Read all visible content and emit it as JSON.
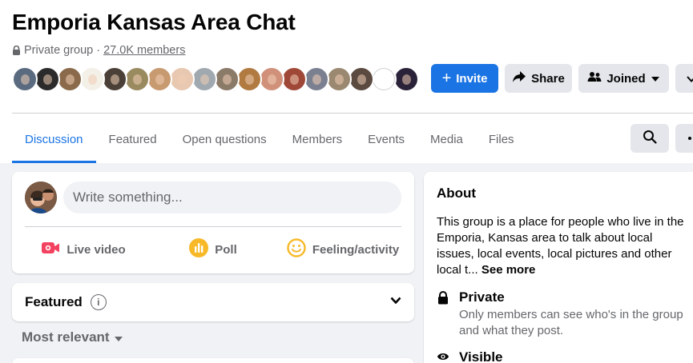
{
  "group": {
    "title": "Emporia Kansas Area Chat",
    "privacy": "Private group",
    "separator": "·",
    "members": "27.0K members"
  },
  "member_avatars": [
    {
      "icon": "avatar-photo",
      "color": "#5a6b80"
    },
    {
      "icon": "avatar-photo",
      "color": "#2b2b2b"
    },
    {
      "icon": "avatar-photo",
      "color": "#8a6a4a"
    },
    {
      "icon": "avatar-photo",
      "color": "#f3f0e8"
    },
    {
      "icon": "avatar-photo",
      "color": "#4a4038"
    },
    {
      "icon": "avatar-photo",
      "color": "#9a8a60"
    },
    {
      "icon": "avatar-photo",
      "color": "#c89a70"
    },
    {
      "icon": "avatar-photo",
      "color": "#e8c8b0"
    },
    {
      "icon": "avatar-photo",
      "color": "#a0a8b0"
    },
    {
      "icon": "avatar-photo",
      "color": "#8a7a68"
    },
    {
      "icon": "avatar-photo",
      "color": "#b07a40"
    },
    {
      "icon": "avatar-photo",
      "color": "#d0907a"
    },
    {
      "icon": "avatar-photo",
      "color": "#a04838"
    },
    {
      "icon": "avatar-photo",
      "color": "#7a8090"
    },
    {
      "icon": "avatar-photo",
      "color": "#9a8870"
    },
    {
      "icon": "avatar-photo",
      "color": "#5a4a40"
    },
    {
      "icon": "avatar-logo",
      "color": "#ffffff"
    },
    {
      "icon": "avatar-photo",
      "color": "#2a2238"
    }
  ],
  "actions": {
    "invite": "Invite",
    "share": "Share",
    "joined": "Joined"
  },
  "tabs": [
    {
      "label": "Discussion",
      "active": true
    },
    {
      "label": "Featured",
      "active": false
    },
    {
      "label": "Open questions",
      "active": false
    },
    {
      "label": "Members",
      "active": false
    },
    {
      "label": "Events",
      "active": false
    },
    {
      "label": "Media",
      "active": false
    },
    {
      "label": "Files",
      "active": false
    }
  ],
  "composer": {
    "placeholder": "Write something...",
    "live_video": "Live video",
    "poll": "Poll",
    "feeling": "Feeling/activity"
  },
  "featured": {
    "title": "Featured",
    "info": "i"
  },
  "sort": {
    "label": "Most relevant"
  },
  "about": {
    "title": "About",
    "description": "This group is a place for people who live in the Emporia, Kansas area to talk about local issues, local events, local pictures and other local t...",
    "see_more": "See more",
    "private_title": "Private",
    "private_desc": "Only members can see who's in the group and what they post.",
    "visible_title": "Visible"
  },
  "colors": {
    "accent": "#1b74e4",
    "live_video": "#f3425f",
    "poll": "#f7b928",
    "feeling": "#f7b928"
  }
}
